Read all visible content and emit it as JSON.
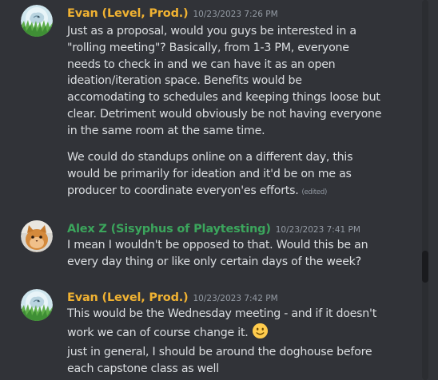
{
  "messages": [
    {
      "author": "Evan (Level, Prod.)",
      "author_color": "#f0b232",
      "timestamp": "10/23/2023 7:26 PM",
      "avatar_icon": "wolf-grass-avatar-icon",
      "paragraphs": [
        {
          "lines": [
            "Just as a proposal, would you guys be interested in a",
            "\"rolling meeting\"?  Basically, from 1-3 PM, everyone",
            "needs to check in and we can have it as an open",
            "ideation/iteration space.  Benefits would be",
            "accomodating to schedules and keeping things loose but",
            "clear.  Detriment would obviously be not having everyone",
            "in the same room at the same time."
          ]
        },
        {
          "lines": [
            "We could do standups online on a different day, this",
            "would be primarily for ideation and it'd be on me as",
            "producer to coordinate everyon'es efforts."
          ],
          "edited_label": "(edited)"
        }
      ]
    },
    {
      "author": "Alex Z (Sisyphus of Playtesting)",
      "author_color": "#3ba55c",
      "timestamp": "10/23/2023 7:41 PM",
      "avatar_icon": "orange-cat-avatar-icon",
      "paragraphs": [
        {
          "lines": [
            "I mean I wouldn't be opposed to that. Would this be an",
            "every day thing or like only certain days of the week?"
          ]
        }
      ]
    },
    {
      "author": "Evan (Level, Prod.)",
      "author_color": "#f0b232",
      "timestamp": "10/23/2023 7:42 PM",
      "avatar_icon": "wolf-grass-avatar-icon",
      "paragraphs": [
        {
          "lines": [
            "This would be the Wednesday meeting - and if it doesn't",
            "work we can of course change it."
          ],
          "emoji": "slight-smile-emoji"
        },
        {
          "lines": [
            "just in general, I should be around the doghouse before",
            "each capstone class as well"
          ]
        }
      ]
    }
  ],
  "scrollbar": {
    "position": 0.68
  }
}
